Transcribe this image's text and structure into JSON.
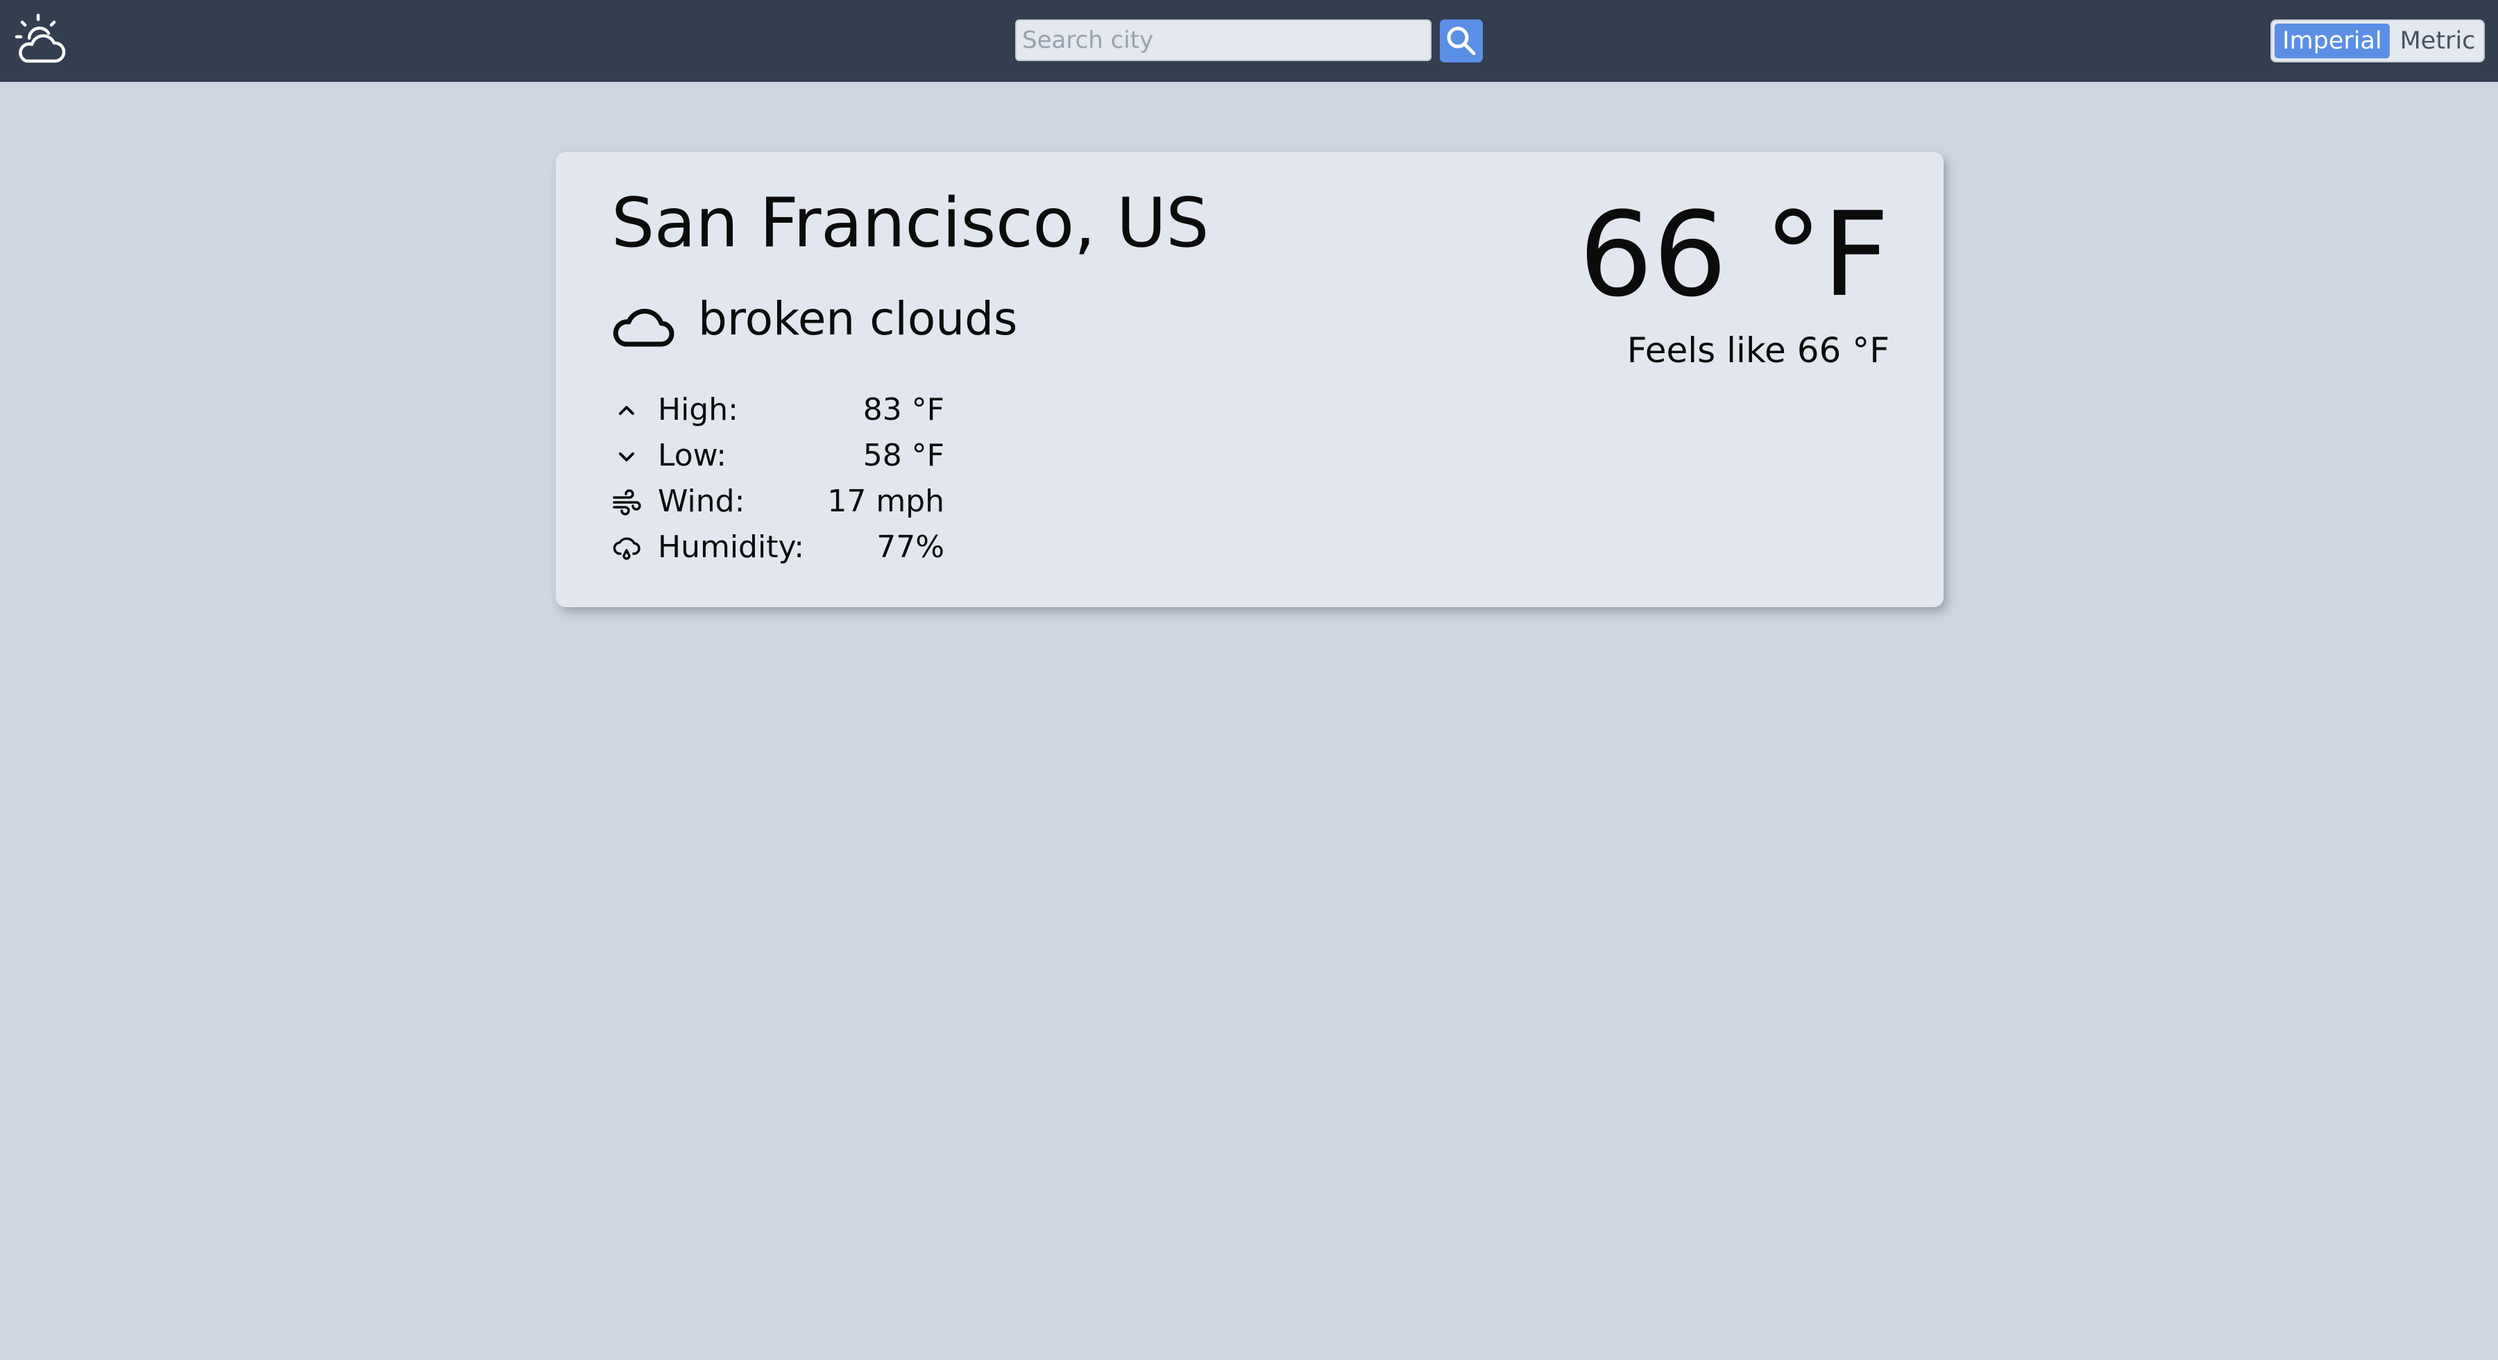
{
  "header": {
    "logo_icon": "sun-behind-cloud-icon",
    "search": {
      "placeholder": "Search city",
      "value": "",
      "button_icon": "search-icon"
    },
    "units": {
      "options": [
        "Imperial",
        "Metric"
      ],
      "selected": "Imperial"
    }
  },
  "weather": {
    "city": "San Francisco, US",
    "condition": "broken clouds",
    "condition_icon": "cloud-icon",
    "temperature": "66 °F",
    "feels_like": "Feels like 66 °F",
    "stats": [
      {
        "label": "High:",
        "value": "83 °F",
        "icon": "chevron-up-icon"
      },
      {
        "label": "Low:",
        "value": "58 °F",
        "icon": "chevron-down-icon"
      },
      {
        "label": "Wind:",
        "value": "17 mph",
        "icon": "wind-icon"
      },
      {
        "label": "Humidity:",
        "value": "77%",
        "icon": "cloud-drizzle-icon"
      }
    ]
  },
  "colors": {
    "header_background": "#343e51",
    "page_background": "#cfd6e1",
    "card_background": "#e2e7ef",
    "accent": "#5b8fe6"
  }
}
